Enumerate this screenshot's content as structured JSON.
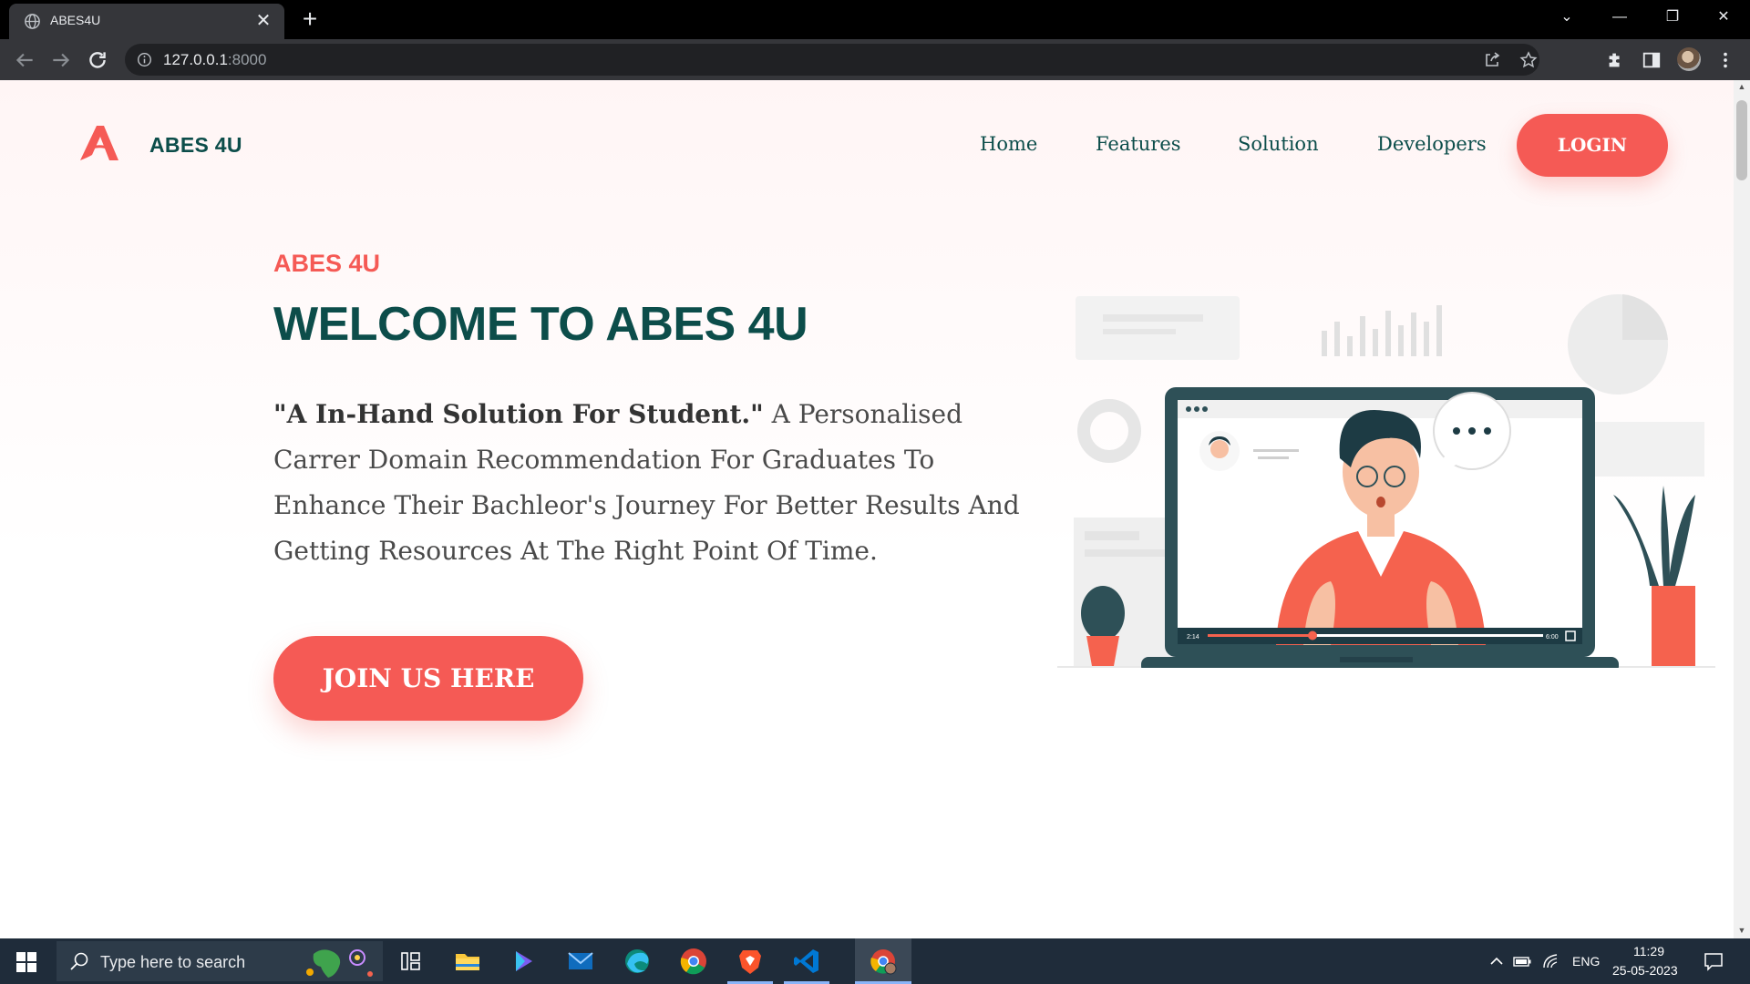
{
  "browser": {
    "tab_title": "ABES4U",
    "new_tab_glyph": "+",
    "close_glyph": "✕",
    "address_host": "127.0.0.1",
    "address_port": ":8000",
    "icons": [
      "back-arrow-icon",
      "forward-arrow-icon",
      "reload-icon",
      "site-info-icon",
      "share-icon",
      "bookmark-star-icon",
      "extensions-icon",
      "side-panel-icon",
      "profile-avatar",
      "menu-dots-icon"
    ],
    "window_controls": {
      "minimize": "—",
      "restore": "❐",
      "close": "✕",
      "tab_search": "⌄"
    }
  },
  "page": {
    "brand": "ABES 4U",
    "nav": [
      "Home",
      "Features",
      "Solution",
      "Developers"
    ],
    "login_label": "LOGIN",
    "eyebrow": "ABES 4U",
    "headline": "WELCOME TO ABES 4U",
    "lead_quote": "\"A In-Hand Solution For Student.\"",
    "lead_body": " A Personalised Carrer Domain Recommendation For Graduates To Enhance Their Bachleor's Journey For Better Results And Getting Resources At The Right Point Of Time.",
    "cta_label": "JOIN US HERE",
    "video_time_start": "2:14",
    "video_time_end": "6:00",
    "colors": {
      "accent": "#f55a55",
      "heading": "#0c4d4a",
      "body_text": "#4a4a4a"
    }
  },
  "taskbar": {
    "search_placeholder": "Type here to search",
    "apps": [
      "task-view-icon",
      "file-explorer-icon",
      "copilot-icon",
      "mail-icon",
      "edge-icon",
      "chrome-icon",
      "brave-icon",
      "vscode-icon",
      "chrome-profile-icon"
    ],
    "language": "ENG",
    "time": "11:29",
    "date": "25-05-2023"
  }
}
